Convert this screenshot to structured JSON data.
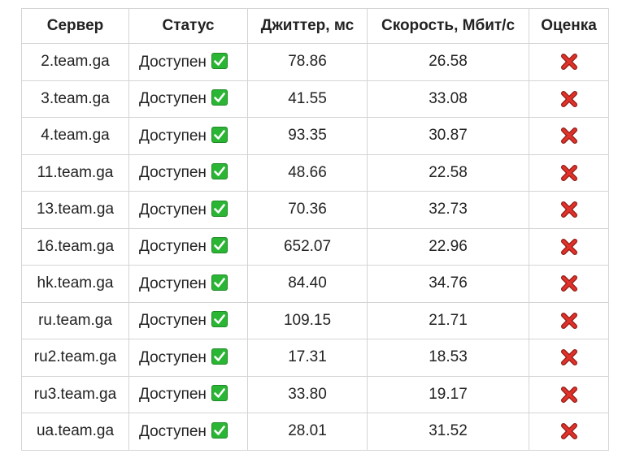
{
  "table": {
    "headers": [
      "Сервер",
      "Статус",
      "Джиттер, мс",
      "Скорость, Мбит/с",
      "Оценка"
    ],
    "rows": [
      {
        "server": "2.team.ga",
        "status": "Доступен",
        "status_icon": "check-mark-icon",
        "jitter": "78.86",
        "speed": "26.58",
        "rating_icon": "cross-mark-icon"
      },
      {
        "server": "3.team.ga",
        "status": "Доступен",
        "status_icon": "check-mark-icon",
        "jitter": "41.55",
        "speed": "33.08",
        "rating_icon": "cross-mark-icon"
      },
      {
        "server": "4.team.ga",
        "status": "Доступен",
        "status_icon": "check-mark-icon",
        "jitter": "93.35",
        "speed": "30.87",
        "rating_icon": "cross-mark-icon"
      },
      {
        "server": "11.team.ga",
        "status": "Доступен",
        "status_icon": "check-mark-icon",
        "jitter": "48.66",
        "speed": "22.58",
        "rating_icon": "cross-mark-icon"
      },
      {
        "server": "13.team.ga",
        "status": "Доступен",
        "status_icon": "check-mark-icon",
        "jitter": "70.36",
        "speed": "32.73",
        "rating_icon": "cross-mark-icon"
      },
      {
        "server": "16.team.ga",
        "status": "Доступен",
        "status_icon": "check-mark-icon",
        "jitter": "652.07",
        "speed": "22.96",
        "rating_icon": "cross-mark-icon"
      },
      {
        "server": "hk.team.ga",
        "status": "Доступен",
        "status_icon": "check-mark-icon",
        "jitter": "84.40",
        "speed": "34.76",
        "rating_icon": "cross-mark-icon"
      },
      {
        "server": "ru.team.ga",
        "status": "Доступен",
        "status_icon": "check-mark-icon",
        "jitter": "109.15",
        "speed": "21.71",
        "rating_icon": "cross-mark-icon"
      },
      {
        "server": "ru2.team.ga",
        "status": "Доступен",
        "status_icon": "check-mark-icon",
        "jitter": "17.31",
        "speed": "18.53",
        "rating_icon": "cross-mark-icon"
      },
      {
        "server": "ru3.team.ga",
        "status": "Доступен",
        "status_icon": "check-mark-icon",
        "jitter": "33.80",
        "speed": "19.17",
        "rating_icon": "cross-mark-icon"
      },
      {
        "server": "ua.team.ga",
        "status": "Доступен",
        "status_icon": "check-mark-icon",
        "jitter": "28.01",
        "speed": "31.52",
        "rating_icon": "cross-mark-icon"
      }
    ]
  },
  "colors": {
    "border": "#d4d4d4",
    "text": "#222222",
    "check_bg": "#2bb534",
    "cross": "#d62a1e"
  }
}
